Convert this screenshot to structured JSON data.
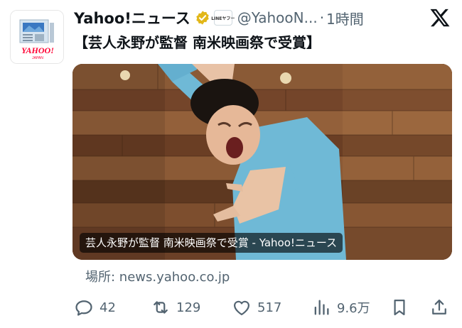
{
  "account": {
    "display_name": "Yahoo!ニュース",
    "handle": "@YahooN...",
    "separator": "·",
    "time": "1時間",
    "affiliate_badge": "LINEヤフー",
    "avatar_logo_text": "YAHOO!",
    "avatar_logo_sub": "JAPAN"
  },
  "tweet": {
    "text": "【芸人永野が監督 南米映画祭で受賞】"
  },
  "card": {
    "caption": "芸人永野が監督 南米映画祭で受賞 - Yahoo!ニュース",
    "source": "場所: news.yahoo.co.jp"
  },
  "metrics": {
    "replies": "42",
    "retweets": "129",
    "likes": "517",
    "views": "9.6万"
  },
  "colors": {
    "text": "#0f1419",
    "muted": "#536471",
    "verified": "#e2b719",
    "yahoo_red": "#ff0033"
  },
  "icons": {
    "reply": "reply-icon",
    "retweet": "retweet-icon",
    "like": "heart-icon",
    "views": "views-icon",
    "bookmark": "bookmark-icon",
    "share": "share-icon",
    "brand": "x-logo-icon"
  }
}
